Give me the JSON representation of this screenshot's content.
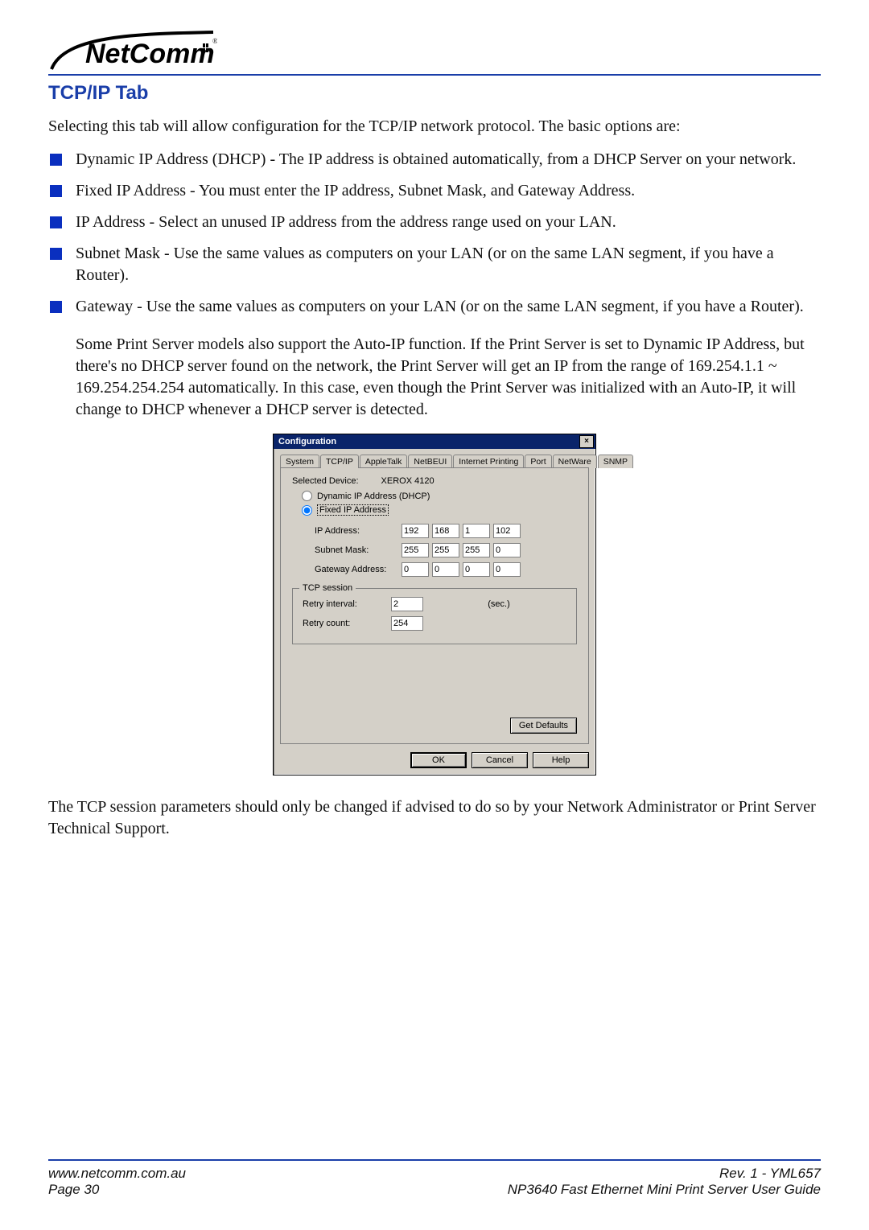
{
  "brand": {
    "name": "NetComm",
    "reg": "®"
  },
  "headings": {
    "section": "TCP/IP Tab"
  },
  "paragraphs": {
    "intro": "Selecting this tab will allow configuration for the TCP/IP network protocol. The basic options are:",
    "autoip": "Some Print Server models also support the Auto-IP function. If the Print Server is set to Dynamic IP Address, but there's no DHCP server found on the network, the Print Server will get an IP from the range of 169.254.1.1 ~ 169.254.254.254 automatically. In this case, even though the Print Server was initialized with an Auto-IP, it will change to DHCP whenever a DHCP server is detected.",
    "tcp_note": "The TCP session parameters should only be changed if advised to do so by your Network Administrator or Print Server Technical Support."
  },
  "bullets": [
    "Dynamic IP Address (DHCP) - The IP address is obtained automatically, from a DHCP Server on your network.",
    "Fixed IP Address - You must enter the IP address, Subnet Mask, and Gateway Address.",
    "IP Address - Select an unused IP address from the address range used on your LAN.",
    "Subnet Mask - Use the same values as computers on your LAN (or on the same LAN segment, if you have a Router).",
    "Gateway - Use the same values as computers on your LAN (or on the same LAN segment, if you have a Router)."
  ],
  "dialog": {
    "title": "Configuration",
    "close": "×",
    "tabs": [
      "System",
      "TCP/IP",
      "AppleTalk",
      "NetBEUI",
      "Internet Printing",
      "Port",
      "NetWare",
      "SNMP"
    ],
    "active_tab_index": 1,
    "selected_device": {
      "label": "Selected Device:",
      "value": "XEROX 4120"
    },
    "radios": {
      "dhcp": "Dynamic IP Address (DHCP)",
      "fixed": "Fixed IP Address"
    },
    "ip": {
      "label": "IP Address:",
      "values": [
        "192",
        "168",
        "1",
        "102"
      ]
    },
    "mask": {
      "label": "Subnet Mask:",
      "values": [
        "255",
        "255",
        "255",
        "0"
      ]
    },
    "gw": {
      "label": "Gateway Address:",
      "values": [
        "0",
        "0",
        "0",
        "0"
      ]
    },
    "tcp": {
      "legend": "TCP session",
      "retry_interval": {
        "label": "Retry interval:",
        "value": "2",
        "unit": "(sec.)"
      },
      "retry_count": {
        "label": "Retry count:",
        "value": "254"
      }
    },
    "buttons": {
      "defaults": "Get Defaults",
      "ok": "OK",
      "cancel": "Cancel",
      "help": "Help"
    }
  },
  "footer": {
    "url": "www.netcomm.com.au",
    "rev": "Rev. 1 - YML657",
    "page": "Page 30",
    "doc": "NP3640  Fast Ethernet Mini Print Server User Guide"
  }
}
